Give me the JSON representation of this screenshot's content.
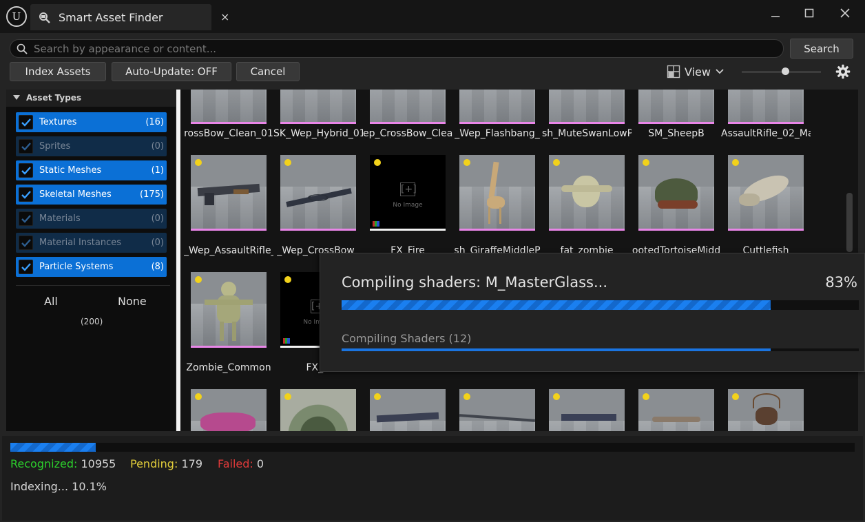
{
  "window": {
    "tab_title": "Smart Asset Finder",
    "tab_close": "×",
    "logo_glyph": "U",
    "icons": [
      "unreal-logo",
      "asset-finder-icon",
      "minimize-icon",
      "maximize-icon",
      "close-icon"
    ]
  },
  "toolbar": {
    "search_placeholder": "Search by appearance or content...",
    "search_value": "",
    "search_label": "Search",
    "index_label": "Index Assets",
    "auto_update_label": "Auto-Update: OFF",
    "cancel_label": "Cancel",
    "view_label": "View",
    "thumbnail_size_fraction": 0.5
  },
  "sidebar": {
    "header": "Asset Types",
    "items": [
      {
        "label": "Textures",
        "count": "(16)",
        "checked": true
      },
      {
        "label": "Sprites",
        "count": "(0)",
        "checked": false
      },
      {
        "label": "Static Meshes",
        "count": "(1)",
        "checked": true
      },
      {
        "label": "Skeletal Meshes",
        "count": "(175)",
        "checked": true
      },
      {
        "label": "Materials",
        "count": "(0)",
        "checked": false
      },
      {
        "label": "Material Instances",
        "count": "(0)",
        "checked": false
      },
      {
        "label": "Particle Systems",
        "count": "(8)",
        "checked": true
      }
    ],
    "all_label": "All",
    "none_label": "None",
    "total": "(200)"
  },
  "grid": {
    "rows": [
      [
        "rossBow_Clean_01",
        "SK_Wep_Hybrid_01",
        "ep_CrossBow_Clea",
        "_Wep_Flashbang_",
        "sh_MuteSwanLowP",
        "SM_SheepB",
        "AssaultRifle_02_Ma"
      ],
      [
        "_Wep_AssaultRifle_",
        "_Wep_CrossBow_",
        "FX_Fire",
        "sh_GiraffeMiddleP",
        "fat_zombie",
        "ootedTortoiseMidd",
        "Cuttlefish"
      ],
      [
        "Zombie_Common",
        "FX_N",
        "",
        "",
        "",
        "",
        ""
      ],
      [
        "",
        "",
        "",
        "",
        "",
        "",
        ""
      ]
    ],
    "no_image_text": "No Image",
    "no_image_glyph": "[+]"
  },
  "overlay": {
    "title": "Compiling shaders: M_MasterGlass...",
    "percent": "83%",
    "progress": 0.83,
    "sub_label": "Compiling Shaders (12)",
    "sub_progress": 0.83
  },
  "status": {
    "progress": 0.101,
    "recognized_label": "Recognized:",
    "recognized_value": "10955",
    "pending_label": "Pending:",
    "pending_value": "179",
    "failed_label": "Failed:",
    "failed_value": "0",
    "indexing_text": "Indexing... 10.1%",
    "colors": {
      "recognized": "#2ccf2c",
      "pending": "#e0cc3a",
      "failed": "#e03a3a",
      "accent": "#0b70d6"
    }
  }
}
